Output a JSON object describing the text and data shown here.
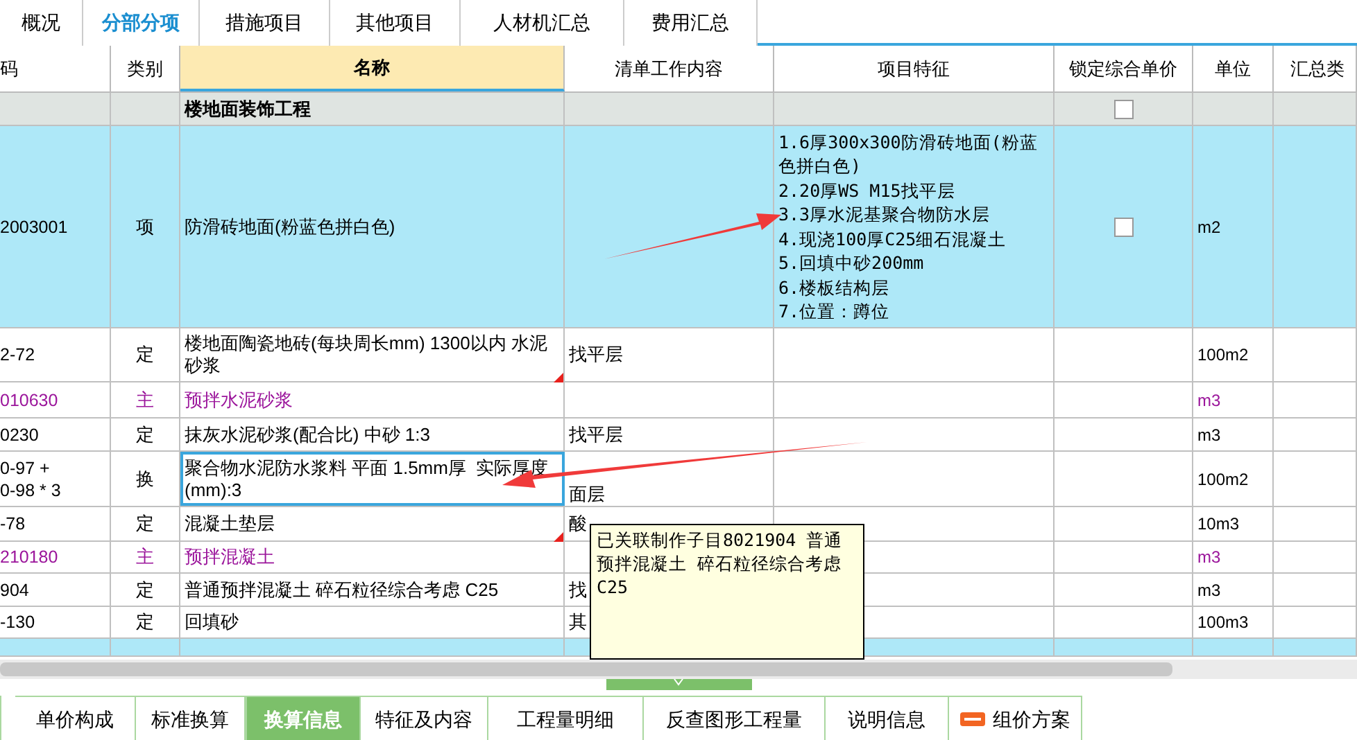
{
  "top_tabs": [
    {
      "label": "概况",
      "selected": false
    },
    {
      "label": "分部分项",
      "selected": true
    },
    {
      "label": "措施项目",
      "selected": false
    },
    {
      "label": "其他项目",
      "selected": false
    },
    {
      "label": "人材机汇总",
      "selected": false
    },
    {
      "label": "费用汇总",
      "selected": false
    }
  ],
  "table": {
    "columns": [
      "码",
      "类别",
      "名称",
      "清单工作内容",
      "项目特征",
      "锁定综合单价",
      "单位",
      "汇总类"
    ],
    "rows": [
      {
        "kind": "section",
        "code": "",
        "type": "",
        "name": "楼地面装饰工程",
        "content": "",
        "features": "",
        "locked": false,
        "unit": "",
        "selected": false,
        "flagged": false,
        "focused": false
      },
      {
        "kind": "list",
        "code": "2003001",
        "type": "项",
        "name": "防滑砖地面(粉蓝色拼白色)",
        "content": "",
        "features": "1.6厚300x300防滑砖地面(粉蓝色拼白色)\n2.20厚WS M15找平层\n3.3厚水泥基聚合物防水层\n4.现浇100厚C25细石混凝土\n5.回填中砂200mm\n6.楼板结构层\n7.位置：蹲位",
        "locked": false,
        "unit": "m2",
        "selected": true,
        "flagged": false,
        "focused": false
      },
      {
        "kind": "quota",
        "code": "2-72",
        "type": "定",
        "name": "楼地面陶瓷地砖(每块周长mm) 1300以内 水泥砂浆",
        "content": "找平层",
        "features": "",
        "unit": "100m2",
        "selected": false,
        "flagged": true,
        "focused": false
      },
      {
        "kind": "main",
        "code": "010630",
        "type": "主",
        "name": "预拌水泥砂浆",
        "content": "",
        "features": "",
        "unit": "m3",
        "selected": false,
        "flagged": false,
        "focused": false
      },
      {
        "kind": "quota",
        "code": "0230",
        "type": "定",
        "name": "抹灰水泥砂浆(配合比) 中砂 1:3",
        "content": "找平层",
        "features": "",
        "unit": "m3",
        "selected": false,
        "flagged": false,
        "focused": false
      },
      {
        "kind": "quota",
        "code": "0-97 +\n0-98 * 3",
        "type": "换",
        "name": "聚合物水泥防水浆料 平面 1.5mm厚  实际厚度(mm):3",
        "content": "面层",
        "features": "",
        "unit": "100m2",
        "selected": false,
        "flagged": false,
        "focused": true
      },
      {
        "kind": "quota",
        "code": "-78",
        "type": "定",
        "name": "混凝土垫层",
        "content": "酸",
        "features": "",
        "unit": "10m3",
        "selected": false,
        "flagged": true,
        "focused": false
      },
      {
        "kind": "main",
        "code": "210180",
        "type": "主",
        "name": "预拌混凝土",
        "content": "",
        "features": "",
        "unit": "m3",
        "selected": false,
        "flagged": false,
        "focused": false
      },
      {
        "kind": "quota",
        "code": "904",
        "type": "定",
        "name": "普通预拌混凝土 碎石粒径综合考虑 C25",
        "content": "找",
        "features": "",
        "unit": "m3",
        "selected": false,
        "flagged": false,
        "focused": false
      },
      {
        "kind": "quota",
        "code": "-130",
        "type": "定",
        "name": "回填砂",
        "content": "其",
        "features": "",
        "unit": "100m3",
        "selected": false,
        "flagged": false,
        "focused": false
      },
      {
        "kind": "list",
        "code": "",
        "type": "",
        "name": "",
        "content": "",
        "features": "",
        "unit": "",
        "selected": true
      }
    ]
  },
  "tooltip": "已关联制作子目8021904 普通预拌混凝土 碎石粒径综合考虑 C25",
  "bottom_tabs": [
    {
      "label": "单价构成",
      "selected": false,
      "new": false
    },
    {
      "label": "标准换算",
      "selected": false,
      "new": false
    },
    {
      "label": "换算信息",
      "selected": true,
      "new": false
    },
    {
      "label": "特征及内容",
      "selected": false,
      "new": false
    },
    {
      "label": "工程量明细",
      "selected": false,
      "new": false
    },
    {
      "label": "反查图形工程量",
      "selected": false,
      "new": false
    },
    {
      "label": "说明信息",
      "selected": false,
      "new": false
    },
    {
      "label": "组价方案",
      "selected": false,
      "new": true
    }
  ]
}
